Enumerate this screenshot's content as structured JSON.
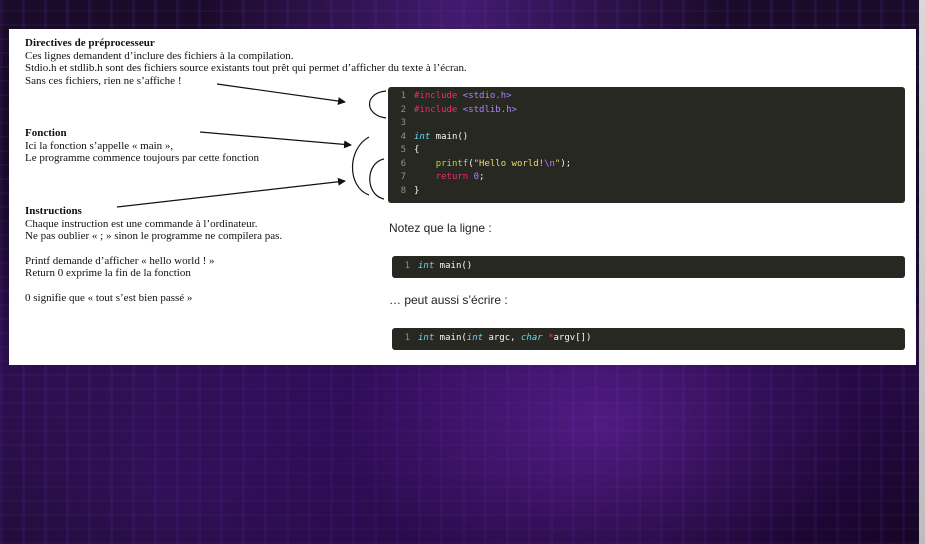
{
  "notes": {
    "preprocessor": {
      "title": "Directives de préprocesseur",
      "line1": "Ces lignes demandent d’inclure des fichiers à la compilation.",
      "line2": "Stdio.h et stdlib.h sont des fichiers source existants tout prêt qui permet d’afficher du texte à l’écran.",
      "line3": "Sans ces fichiers, rien ne s’affiche !"
    },
    "function": {
      "title": "Fonction",
      "line1": "Ici la fonction s’appelle « main »,",
      "line2": "Le programme commence toujours par cette fonction"
    },
    "instructions": {
      "title": "Instructions",
      "line1": "Chaque instruction est une commande à l’ordinateur.",
      "line2": "Ne pas oublier « ; » sinon le programme ne compilera pas.",
      "line3": "Printf demande d’afficher « hello world ! »",
      "line4": "Return 0 exprime la fin de la fonction",
      "line5": "0 signifie que « tout s’est bien passé »"
    }
  },
  "code_main": {
    "lines": [
      {
        "n": "1",
        "pp": "#include",
        "inc": "<stdio.h>"
      },
      {
        "n": "2",
        "pp": "#include",
        "inc": "<stdlib.h>"
      },
      {
        "n": "3"
      },
      {
        "n": "4",
        "type": "int",
        "rest": " main()"
      },
      {
        "n": "5",
        "rest": "{"
      },
      {
        "n": "6",
        "fn": "printf",
        "open": "(",
        "str": "\"Hello world!",
        "esc": "\\n",
        "strend": "\"",
        "close": ");"
      },
      {
        "n": "7",
        "ret": "return",
        "num": "0",
        "semi": ";"
      },
      {
        "n": "8",
        "rest": "}"
      }
    ]
  },
  "remark1": "Notez que la ligne :",
  "code_short": {
    "n": "1",
    "type": "int",
    "rest": " main()"
  },
  "remark2": "… peut aussi s’écrire :",
  "code_long": {
    "n": "1",
    "type1": "int",
    "mid1": " main(",
    "type2": "int",
    "mid2": " argc, ",
    "type3": "char",
    "ptr": " *",
    "rest": "argv[])"
  },
  "colors": {
    "code_bg": "#272822",
    "keyword_type": "#66d9ef",
    "preprocessor": "#f92672",
    "include_path": "#ae81ff",
    "string": "#e6db74",
    "function": "#a6e22e"
  }
}
